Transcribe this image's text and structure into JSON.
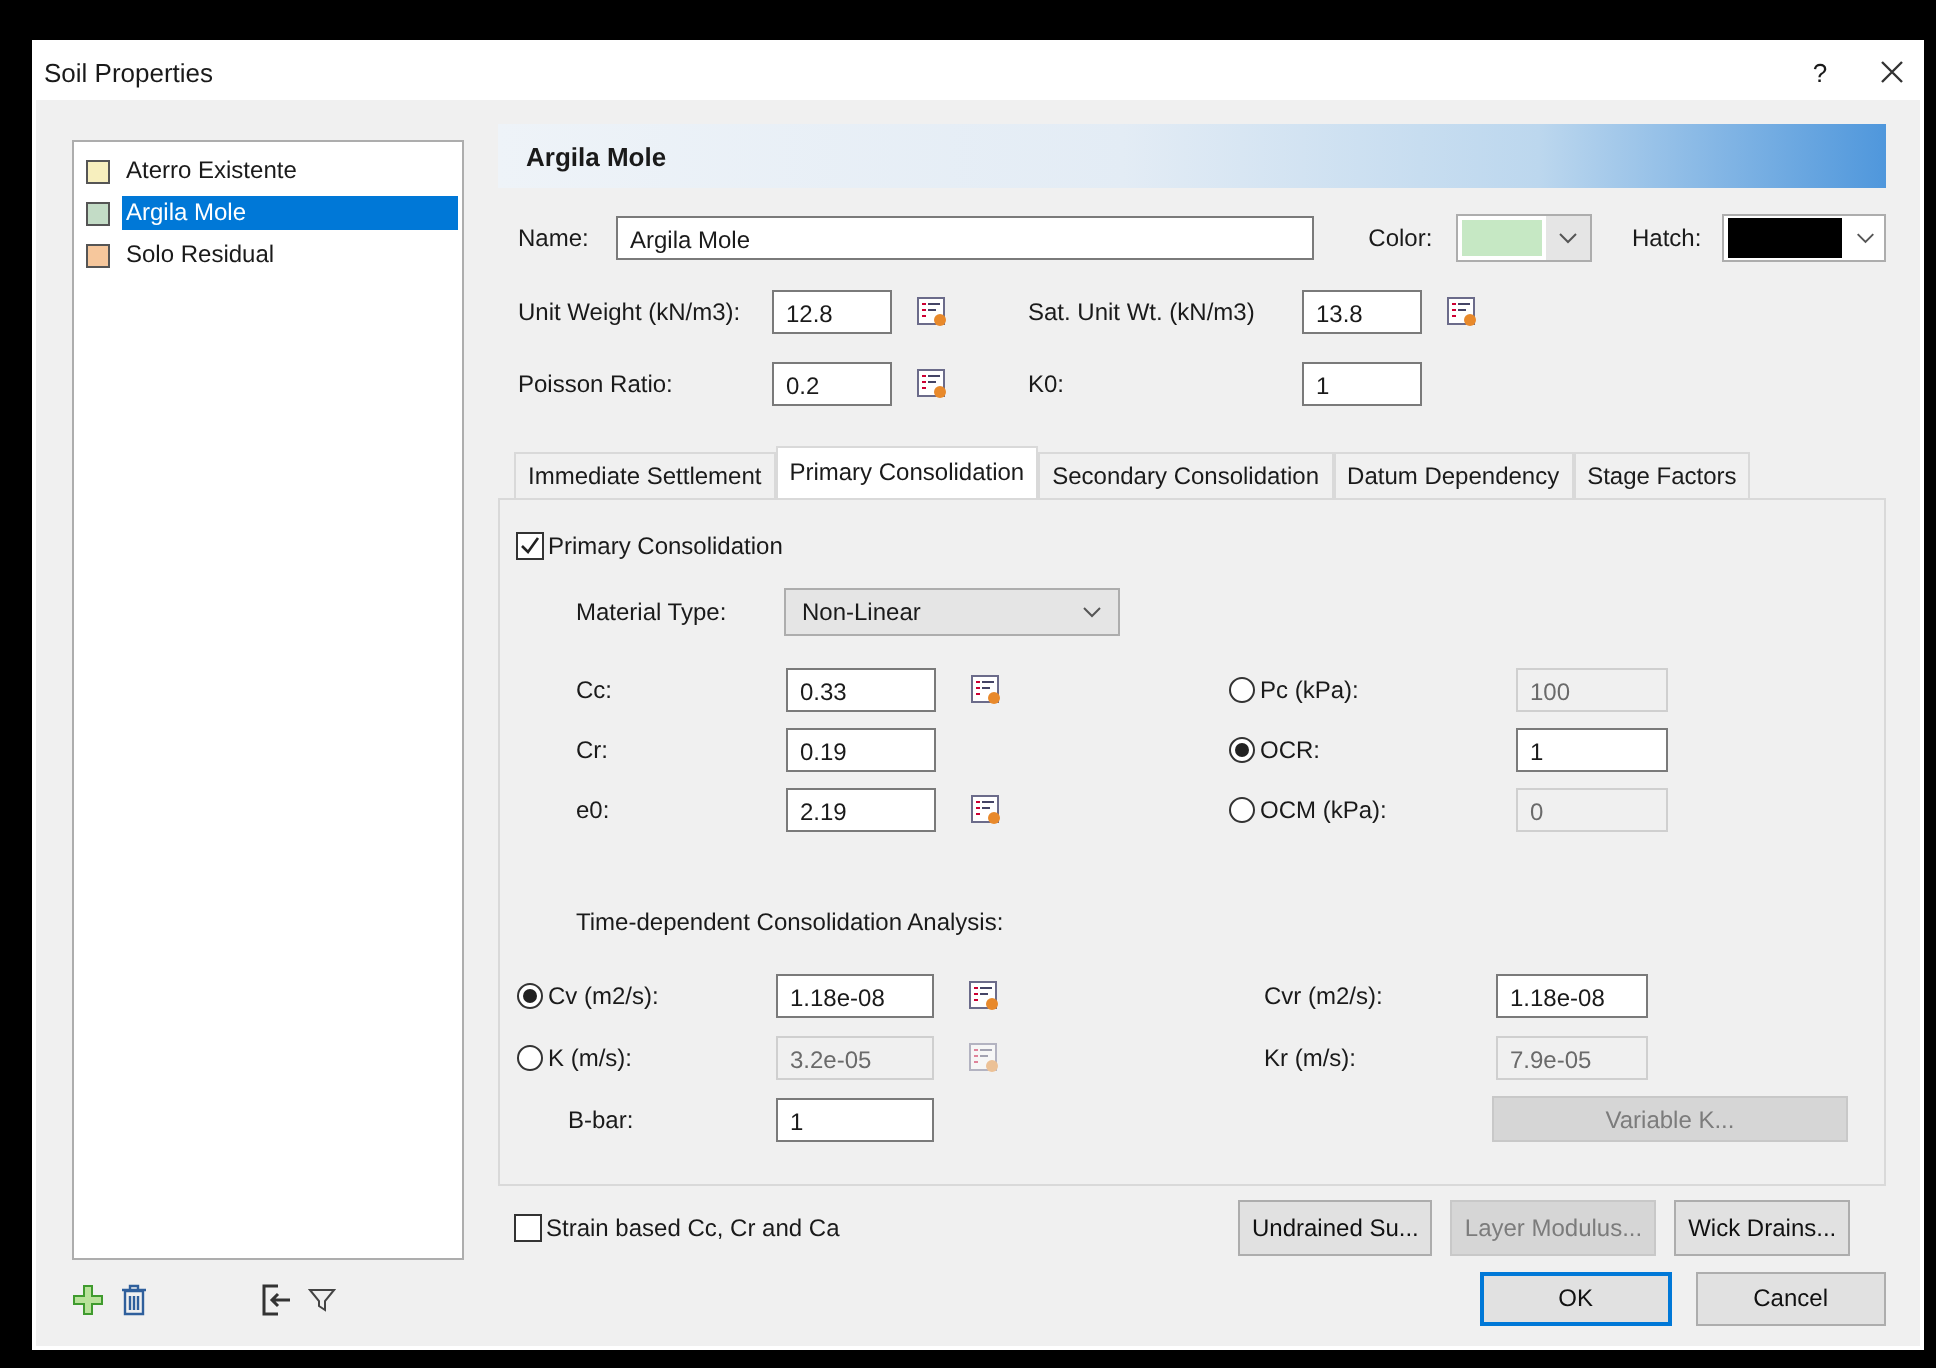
{
  "window": {
    "title": "Soil Properties",
    "help_button": "?"
  },
  "materials": [
    {
      "name": "Aterro Existente",
      "color": "#f7efbe",
      "selected": false
    },
    {
      "name": "Argila Mole",
      "color": "#c3dcc6",
      "selected": true
    },
    {
      "name": "Solo Residual",
      "color": "#f6c79c",
      "selected": false
    }
  ],
  "header": "Argila Mole",
  "name_field": {
    "label": "Name:",
    "value": "Argila Mole"
  },
  "color_picker": {
    "label": "Color:"
  },
  "hatch_picker": {
    "label": "Hatch:"
  },
  "properties": [
    {
      "label": "Unit Weight (kN/m3):",
      "value": "12.8",
      "function": true
    },
    {
      "label": "Sat. Unit Wt. (kN/m3)",
      "value": "13.8",
      "function": true
    },
    {
      "label": "Poisson Ratio:",
      "value": "0.2",
      "function": true
    },
    {
      "label": "K0:",
      "value": "1",
      "function": false
    }
  ],
  "tabs": [
    {
      "label": "Immediate Settlement",
      "selected": false
    },
    {
      "label": "Primary Consolidation",
      "selected": true
    },
    {
      "label": "Secondary Consolidation",
      "selected": false
    },
    {
      "label": "Datum Dependency",
      "selected": false
    },
    {
      "label": "Stage Factors",
      "selected": false
    }
  ],
  "primary_consolidation": {
    "label": "Primary Consolidation",
    "checked": true
  },
  "material_type": {
    "label": "Material Type:",
    "value": "Non-Linear"
  },
  "parameters": [
    {
      "label": "Cc:",
      "value": "0.33",
      "function": true
    },
    {
      "label": "Cr:",
      "value": "0.19",
      "function": false
    },
    {
      "label": "e0:",
      "value": "2.19",
      "function": true
    }
  ],
  "preconsolidation": [
    {
      "label": "Pc (kPa):",
      "value": "100",
      "selected": false
    },
    {
      "label": "OCR:",
      "value": "1",
      "selected": true
    },
    {
      "label": "OCM (kPa):",
      "value": "0",
      "selected": false
    }
  ],
  "time_label": "Time-dependent Consolidation Analysis:",
  "time_rows": [
    {
      "kind": "radio",
      "label": "Cv (m2/s):",
      "value": "1.18e-08",
      "selected": true,
      "function": true
    },
    {
      "kind": "radio",
      "label": "K (m/s):",
      "value": "3.2e-05",
      "selected": false,
      "function": true
    },
    {
      "kind": "plain",
      "label": "B-bar:",
      "value": "1",
      "disabled": false
    }
  ],
  "time_right": [
    {
      "kind": "field",
      "label": "Cvr (m2/s):",
      "value": "1.18e-08",
      "disabled": false
    },
    {
      "kind": "field",
      "label": "Kr (m/s):",
      "value": "7.9e-05",
      "disabled": true
    },
    {
      "kind": "button",
      "label": "Variable K...",
      "disabled": true
    }
  ],
  "strain_based": {
    "label": "Strain based Cc, Cr and Ca",
    "checked": false
  },
  "action_buttons": [
    {
      "label": "Undrained Su...",
      "disabled": false
    },
    {
      "label": "Layer Modulus...",
      "disabled": true
    },
    {
      "label": "Wick Drains...",
      "disabled": false
    }
  ],
  "dialog_buttons": [
    {
      "label": "OK",
      "default": true
    },
    {
      "label": "Cancel",
      "default": false
    }
  ]
}
